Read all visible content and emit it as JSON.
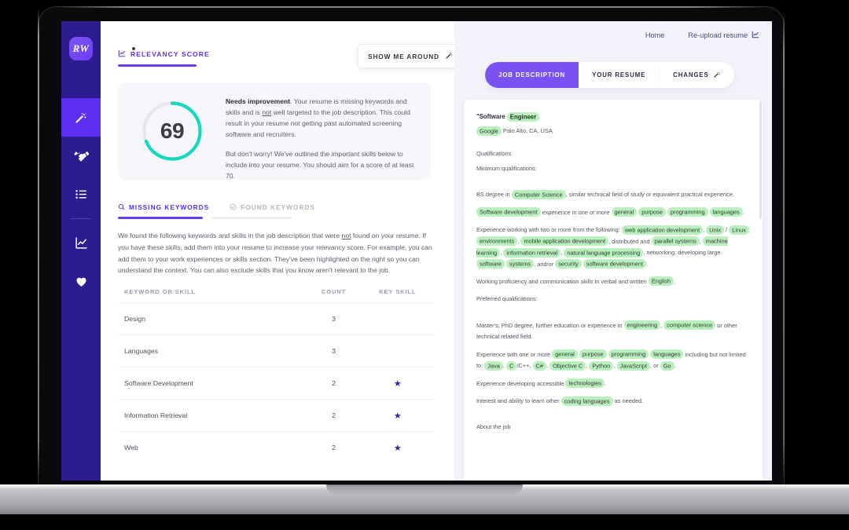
{
  "app": {
    "logo_text": "RW",
    "sidebar_items": [
      {
        "name": "magic-wand",
        "label": "Optimize"
      },
      {
        "name": "handshake",
        "label": "Matches"
      },
      {
        "name": "list",
        "label": "Lists"
      },
      {
        "name": "chart",
        "label": "Analytics"
      },
      {
        "name": "heart",
        "label": "Saved"
      }
    ]
  },
  "left": {
    "section_label": "RELEVANCY SCORE",
    "tour_button": "SHOW ME AROUND",
    "score": {
      "value": "69",
      "percent": 69,
      "headline": "Needs improvement",
      "paragraph1_a": ". Your resume is missing keywords and skills and is ",
      "paragraph1_not": "not",
      "paragraph1_b": " well targeted to the job description. This could result in your resume not getting past automated screening software and recruiters.",
      "paragraph2": "But don't worry! We've outlined the important skills below to include into your resume. You should aim for a score of at least 70.",
      "ring_color": "#16d8be",
      "track_color": "#e6e6ee"
    },
    "tabs": [
      {
        "label": "MISSING KEYWORDS",
        "icon": "search-icon",
        "active": true
      },
      {
        "label": "FOUND KEYWORDS",
        "icon": "check-circle-icon",
        "active": false
      }
    ],
    "description_a": "We found the following keywords and skills in the job description that were ",
    "description_not": "not",
    "description_b": " found on your resume. If you have these skills, add them into your resume to increase your relevancy score. For example, you can add them to your work experiences or skills section. They've been highlighted on the right so you can understand the context. You can also exclude skills that you know aren't relevant to the job.",
    "table": {
      "columns": [
        "KEYWORD OR SKILL",
        "COUNT",
        "KEY SKILL"
      ],
      "rows": [
        {
          "keyword": "Design",
          "count": "3",
          "key_skill": false
        },
        {
          "keyword": "Languages",
          "count": "3",
          "key_skill": false
        },
        {
          "keyword": "Software Development",
          "count": "2",
          "key_skill": true
        },
        {
          "keyword": "Information Retrieval",
          "count": "2",
          "key_skill": true
        },
        {
          "keyword": "Web",
          "count": "2",
          "key_skill": true
        }
      ]
    }
  },
  "right": {
    "nav": {
      "home": "Home",
      "reupload": "Re-upload resume"
    },
    "segments": [
      {
        "label": "JOB DESCRIPTION",
        "active": true,
        "icon": null
      },
      {
        "label": "YOUR RESUME",
        "active": false,
        "icon": null
      },
      {
        "label": "CHANGES",
        "active": false,
        "icon": "magic-wand-icon"
      }
    ],
    "doc": {
      "title_pre": "\"Software ",
      "title_hl": "Engineer",
      "company_hl": "Google",
      "company_rest": " Palo Alto, CA, USA",
      "qualifications_label": "Qualifications",
      "minimum_label": "Minimum qualifications:",
      "preferred_label": "Preferred qualifications:",
      "about_label": "About the job",
      "lines": [
        {
          "id": "bs",
          "parts": [
            {
              "t": "BS degree in "
            },
            {
              "t": "Computer Science",
              "hl": true
            },
            {
              "t": ", similar technical field of study or equivalent practical experience."
            }
          ]
        },
        {
          "id": "softdev",
          "parts": [
            {
              "t": "Software development",
              "hl": true
            },
            {
              "t": " experience in one or more "
            },
            {
              "t": "general",
              "hl": true
            },
            {
              "t": " "
            },
            {
              "t": "purpose",
              "hl": true
            },
            {
              "t": " "
            },
            {
              "t": "programming",
              "hl": true
            },
            {
              "t": " "
            },
            {
              "t": "languages",
              "hl": true
            },
            {
              "t": "."
            }
          ]
        },
        {
          "id": "exp2",
          "parts": [
            {
              "t": "Experience working with two or more from the following: "
            },
            {
              "t": "web application development",
              "hl": true
            },
            {
              "t": ", "
            },
            {
              "t": "Unix",
              "hl": true
            },
            {
              "t": " / "
            },
            {
              "t": "Linux",
              "hl": true
            },
            {
              "t": " "
            },
            {
              "t": "environments",
              "hl": true
            },
            {
              "t": ", "
            },
            {
              "t": "mobile application development",
              "hl": true
            },
            {
              "t": ", distributed and "
            },
            {
              "t": "parallel systems",
              "hl": true
            },
            {
              "t": ", "
            },
            {
              "t": "machine learning",
              "hl": true
            },
            {
              "t": ", "
            },
            {
              "t": "information retrieval",
              "hl": true
            },
            {
              "t": ", "
            },
            {
              "t": "natural language processing",
              "hl": true
            },
            {
              "t": ", networking, developing large "
            },
            {
              "t": "software",
              "hl": true
            },
            {
              "t": " "
            },
            {
              "t": "systems",
              "hl": true
            },
            {
              "t": ", and/or "
            },
            {
              "t": "security",
              "hl": true
            },
            {
              "t": " "
            },
            {
              "t": "software development",
              "hl": true
            },
            {
              "t": "."
            }
          ]
        },
        {
          "id": "english",
          "parts": [
            {
              "t": "Working proficiency and communication skills in verbal and written "
            },
            {
              "t": "English",
              "hl": true
            },
            {
              "t": "."
            }
          ]
        },
        {
          "id": "masters",
          "parts": [
            {
              "t": "Master's, PhD degree, further education or experience in "
            },
            {
              "t": "engineering",
              "hl": true
            },
            {
              "t": ", "
            },
            {
              "t": "computer science",
              "hl": true
            },
            {
              "t": " or other technical related field."
            }
          ]
        },
        {
          "id": "langs",
          "parts": [
            {
              "t": "Experience with one or more "
            },
            {
              "t": "general",
              "hl": true
            },
            {
              "t": " "
            },
            {
              "t": "purpose",
              "hl": true
            },
            {
              "t": " "
            },
            {
              "t": "programming",
              "hl": true
            },
            {
              "t": " "
            },
            {
              "t": "languages",
              "hl": true
            },
            {
              "t": " including but not limited to: "
            },
            {
              "t": "Java",
              "hl": true
            },
            {
              "t": ", "
            },
            {
              "t": "C",
              "hl": true
            },
            {
              "t": "/C++, "
            },
            {
              "t": "C#",
              "hl": true
            },
            {
              "t": ", "
            },
            {
              "t": "Objective C",
              "hl": true
            },
            {
              "t": ", "
            },
            {
              "t": "Python",
              "hl": true
            },
            {
              "t": ", "
            },
            {
              "t": "JavaScript",
              "hl": true
            },
            {
              "t": ", or "
            },
            {
              "t": "Go",
              "hl": true
            },
            {
              "t": "."
            }
          ]
        },
        {
          "id": "access",
          "parts": [
            {
              "t": "Experience developing accessible "
            },
            {
              "t": "technologies",
              "hl": true
            },
            {
              "t": "."
            }
          ]
        },
        {
          "id": "coding",
          "parts": [
            {
              "t": "Interest and ability to learn other "
            },
            {
              "t": "coding languages",
              "hl": true
            },
            {
              "t": " as needed."
            }
          ]
        }
      ]
    }
  },
  "theme": {
    "purple": "#5b2ef0",
    "deep_purple": "#2b1c8f",
    "teal": "#16d8be",
    "highlight_green": "#b9f0bd",
    "star_blue": "#2b2a8c"
  }
}
